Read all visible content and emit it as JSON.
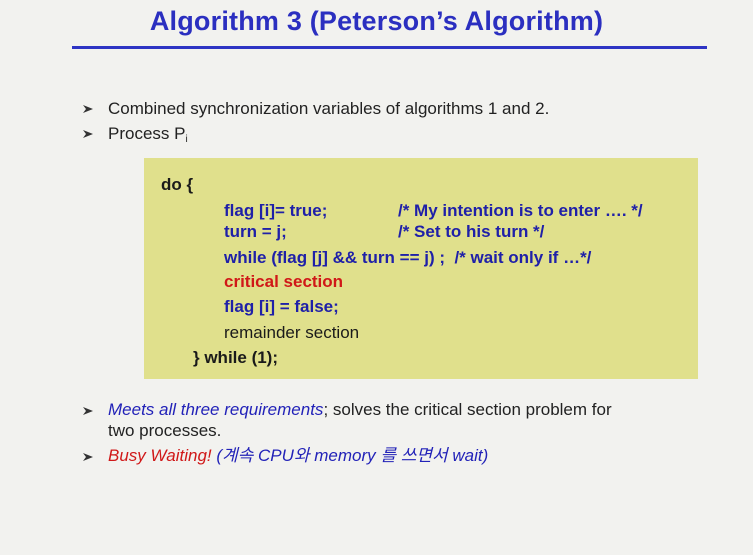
{
  "title": "Algorithm 3 (Peterson’s Algorithm)",
  "bullets": {
    "b1": "Combined synchronization variables of algorithms 1 and 2.",
    "b2_main": "Process P",
    "b2_sub": "i",
    "b3_blue": "Meets all three requirements",
    "b3_rest": "; solves the critical section problem for",
    "b3_line2": "two processes.",
    "b4_red": "Busy Waiting!",
    "b4_blue": " (계속 CPU와  memory 를 쓰면서 wait)"
  },
  "code": {
    "do": "do {",
    "flag_true": "flag [i]= true;",
    "comment1": "/* My intention is to enter …. */",
    "turn": "turn = j;",
    "comment2": "/* Set to his turn */",
    "while_line": "while (flag [j] && turn == j) ;  /* wait only if …*/",
    "critical": "critical section",
    "flag_false": "flag [i] = false;",
    "remainder": "remainder section",
    "end": "} while (1);"
  },
  "colors": {
    "title": "#2b2fc0",
    "code_bg": "#e0e08c",
    "code_blue": "#1f20a8",
    "critical_red": "#d01818"
  }
}
